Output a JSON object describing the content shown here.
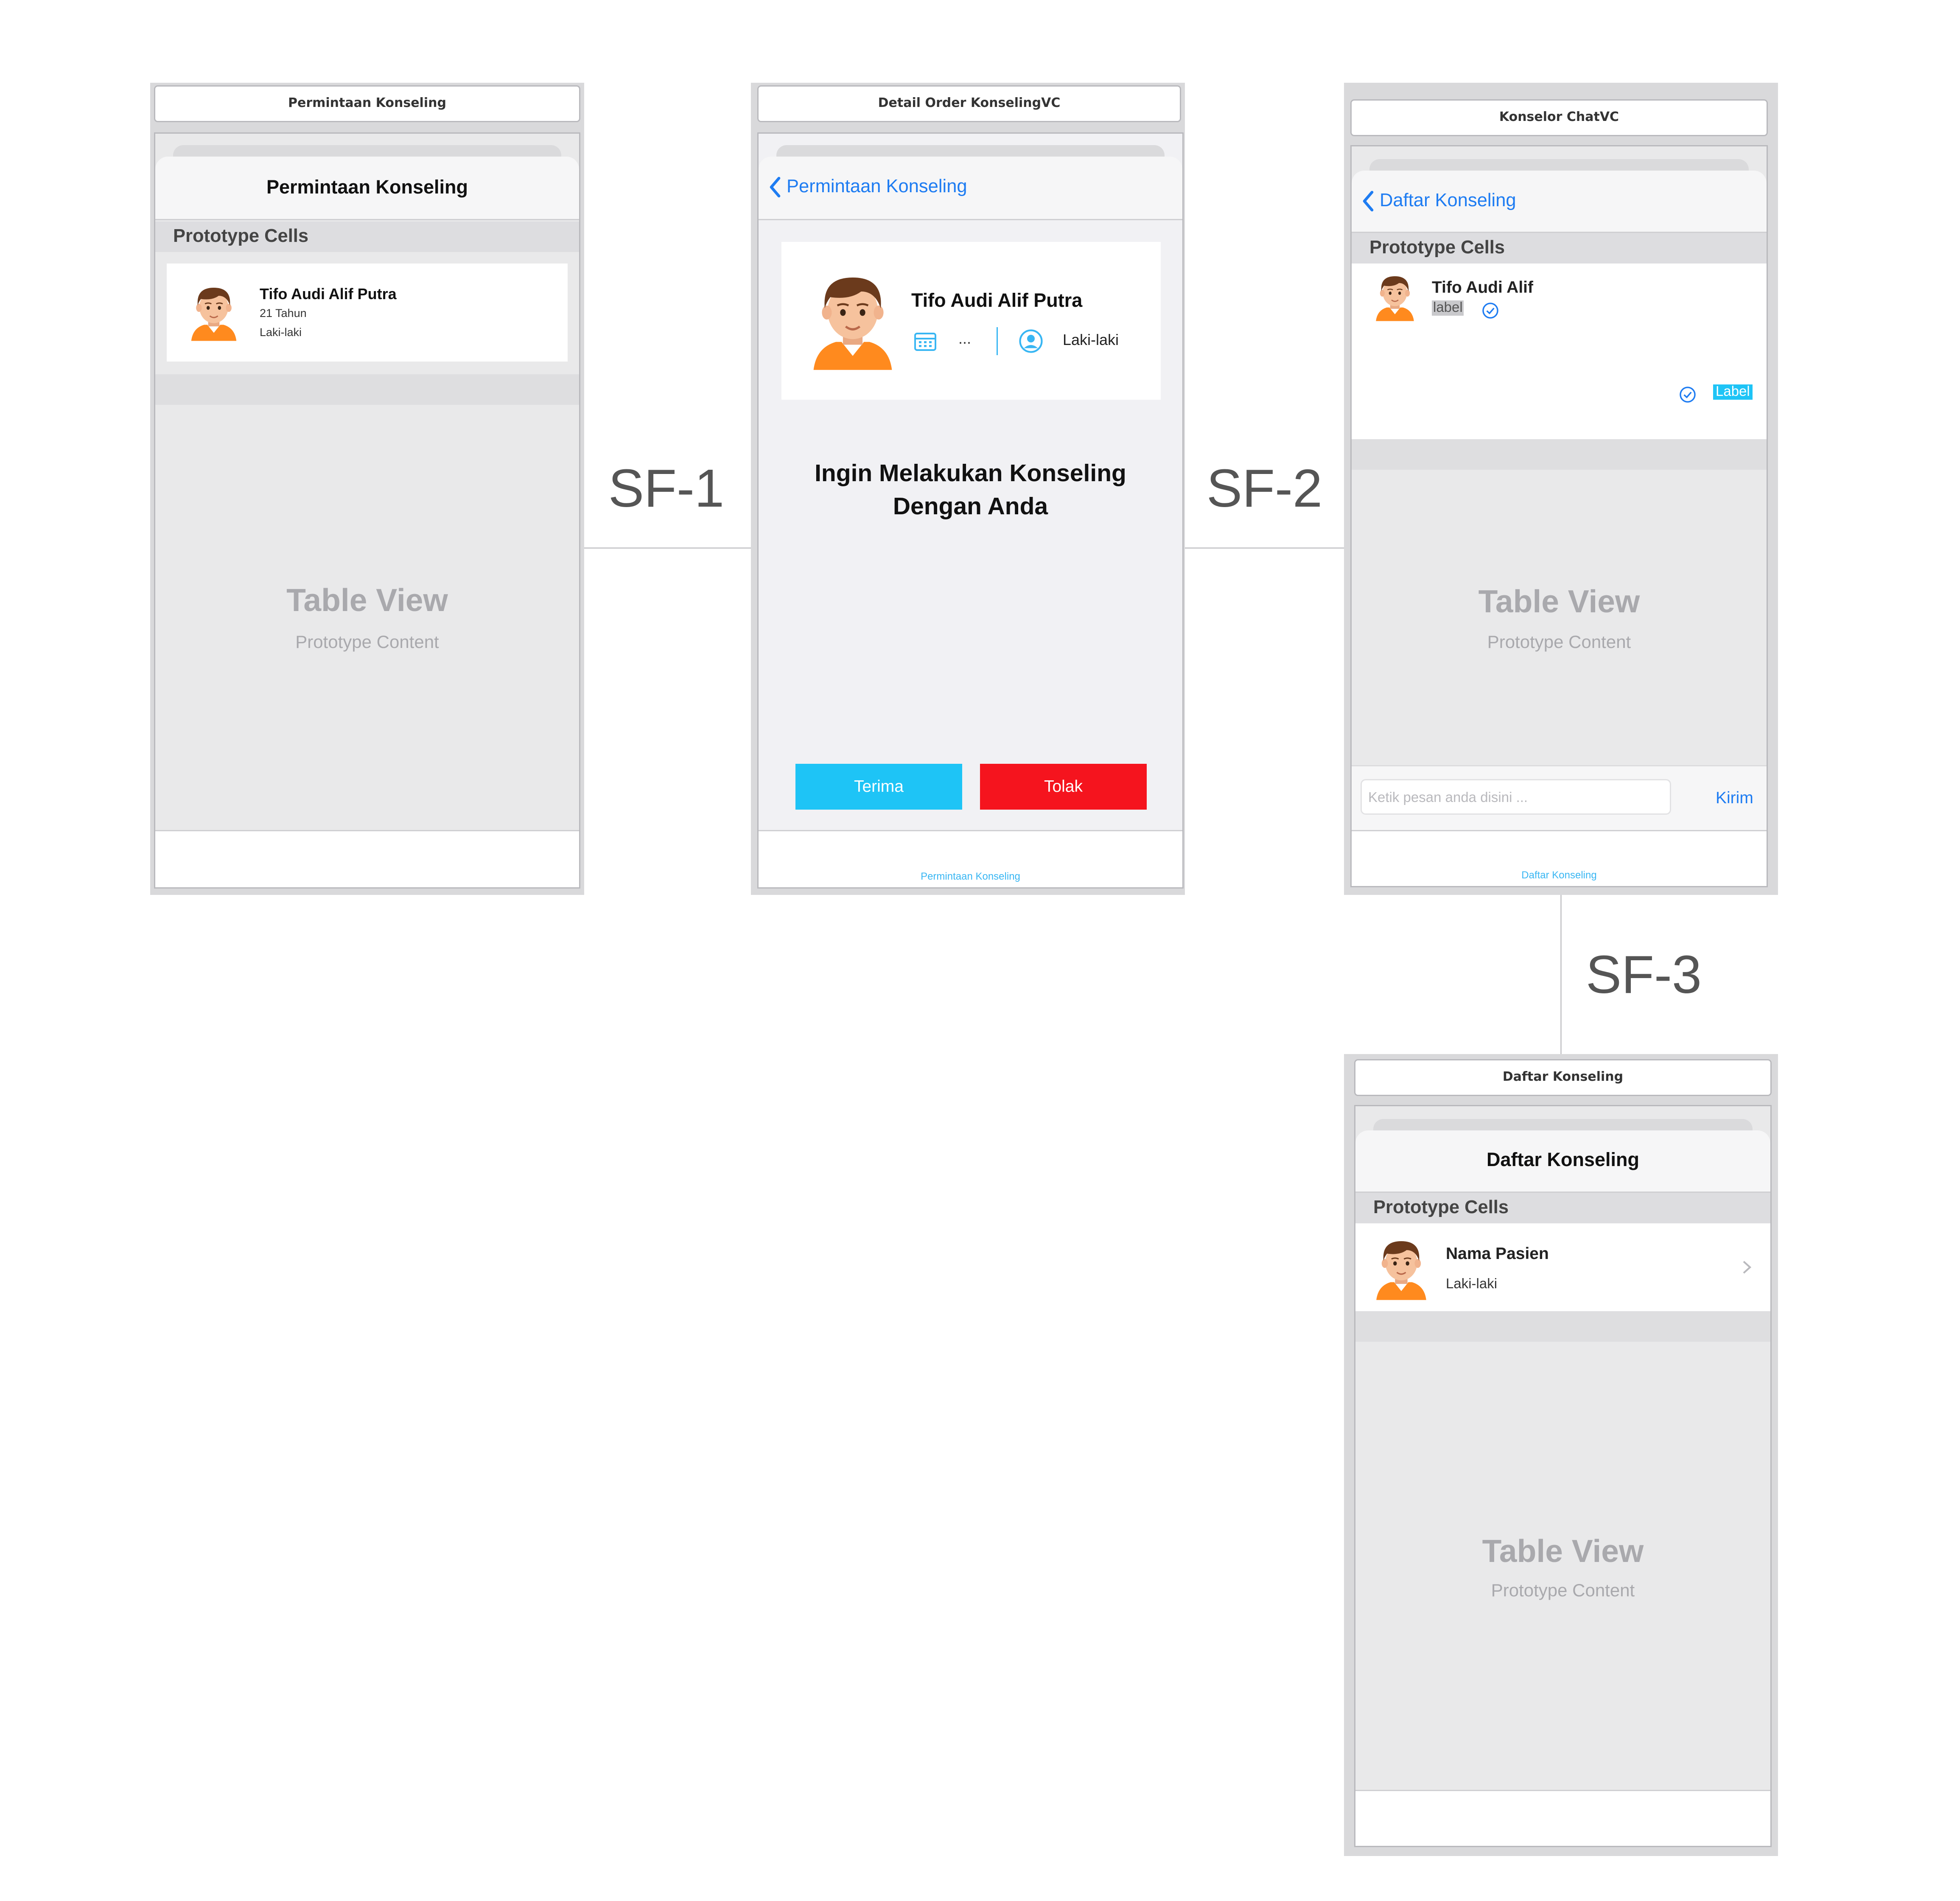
{
  "segues": {
    "sf1": "SF-1",
    "sf2": "SF-2",
    "sf3": "SF-3"
  },
  "scene1": {
    "scene_title": "Permintaan Konseling",
    "nav_title": "Permintaan Konseling",
    "section_header": "Prototype Cells",
    "cell": {
      "name": "Tifo Audi Alif Putra",
      "age": "21 Tahun",
      "gender": "Laki-laki"
    },
    "table_view": "Table View",
    "table_view_sub": "Prototype Content"
  },
  "scene2": {
    "scene_title": "Detail Order KonselingVC",
    "back_label": "Permintaan Konseling",
    "card": {
      "name": "Tifo Audi Alif Putra",
      "date": "...",
      "gender": "Laki-laki"
    },
    "message_line1": "Ingin Melakukan Konseling",
    "message_line2": "Dengan Anda",
    "accept_label": "Terima",
    "reject_label": "Tolak",
    "bottom_label": "Permintaan Konseling"
  },
  "scene3": {
    "scene_title": "Konselor ChatVC",
    "back_label": "Daftar Konseling",
    "section_header": "Prototype Cells",
    "cell": {
      "name": "Tifo Audi Alif",
      "incoming_label": "label",
      "outgoing_label": "Label"
    },
    "table_view": "Table View",
    "table_view_sub": "Prototype Content",
    "input_placeholder": "Ketik pesan anda disini ...",
    "send_label": "Kirim",
    "bottom_label": "Daftar Konseling"
  },
  "scene4": {
    "scene_title": "Daftar Konseling",
    "nav_title": "Daftar Konseling",
    "section_header": "Prototype Cells",
    "cell": {
      "name": "Nama Pasien",
      "gender": "Laki-laki"
    },
    "table_view": "Table View",
    "table_view_sub": "Prototype Content"
  },
  "colors": {
    "accent_blue": "#1e7cf2",
    "cyan_button": "#1ec4f6",
    "red_button": "#f5141e",
    "segue_line": "#c9c9cc"
  },
  "icons": [
    "chevron-left-icon",
    "avatar-boy-icon",
    "calendar-icon",
    "user-circle-icon",
    "checkmark-circle-icon",
    "chevron-right-icon"
  ]
}
